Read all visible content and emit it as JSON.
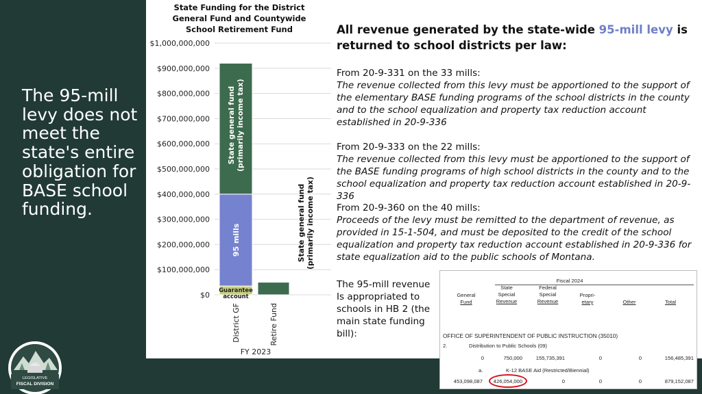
{
  "sidebar": {
    "text": "The 95-mill levy does not meet the state's entire obligation for BASE school funding.",
    "logo_text_1": "LEGISLATIVE",
    "logo_text_2": "FISCAL DIVISION"
  },
  "colors": {
    "sidebar": "#213a35",
    "bar_green": "#3d6b4e",
    "bar_blue": "#7582cf",
    "bar_guarantee": "#c9d07c",
    "heading_highlight": "#6f7fc8",
    "circle": "#d3141c"
  },
  "chart_data": {
    "type": "bar",
    "title": "State Funding for the District General Fund and Countywide School Retirement Fund",
    "categories": [
      "District GF",
      "Retire Fund"
    ],
    "xlabel": "FY 2023",
    "ylim": [
      0,
      1000000000
    ],
    "yticks": [
      "$0",
      "$100,000,000",
      "$200,000,000",
      "$300,000,000",
      "$400,000,000",
      "$500,000,000",
      "$600,000,000",
      "$700,000,000",
      "$800,000,000",
      "$900,000,000",
      "$1,000,000,000"
    ],
    "stacked": true,
    "series": [
      {
        "name": "Guarantee account",
        "color": "#c9d07c",
        "values": [
          35000000,
          0
        ]
      },
      {
        "name": "95 mills",
        "color": "#7582cf",
        "values": [
          365000000,
          0
        ]
      },
      {
        "name": "State general fund (primarily income tax)",
        "color": "#3d6b4e",
        "values": [
          520000000,
          50000000
        ]
      }
    ],
    "segment_labels": {
      "guarantee": "Guarantee account",
      "mills": "95 mills",
      "district_gf_1": "State general fund",
      "district_gf_2": "(primarily income tax)",
      "retire_1": "State general fund",
      "retire_2": "(primarily income tax)"
    }
  },
  "main": {
    "heading_1": "All revenue generated by the state-wide ",
    "heading_hl": "95-mill levy",
    "heading_2": " is returned to school districts per law:",
    "statutes": [
      {
        "cite": "From 20-9-331 on the 33 mills:",
        "quote": "The revenue collected from this levy must be apportioned to the support of the elementary BASE funding programs of the school districts in the county and to the school equalization and property tax reduction account established in 20-9-336"
      },
      {
        "cite": "From 20-9-333 on the 22 mills:",
        "quote": "The revenue collected from this levy must be apportioned to the support of the BASE funding programs of high school districts in the county and to the school equalization and property tax reduction account established in 20-9-336"
      },
      {
        "cite": "From 20-9-360 on the 40 mills:",
        "quote": "Proceeds of the levy must be remitted to the department of revenue, as provided in 15-1-504, and must be deposited to the credit of the school equalization and property tax reduction account established in 20-9-336 for state equalization aid to the public schools of Montana."
      }
    ],
    "hb2_text": "The 95-mill revenue Is appropriated to schools in HB 2 (the main state funding bill):"
  },
  "budget_table": {
    "fiscal_year": "Fiscal 2024",
    "columns": [
      [
        "General",
        "Fund"
      ],
      [
        "State",
        "Special",
        "Revenue"
      ],
      [
        "Federal",
        "Special",
        "Revenue"
      ],
      [
        "Propri-",
        "etary"
      ],
      [
        "Other"
      ],
      [
        "Total"
      ]
    ],
    "agency": "OFFICE OF SUPERINTENDENT OF PUBLIC INSTRUCTION (35010)",
    "program_num": "2.",
    "program": "Distribution to Public Schools (09)",
    "program_values": [
      "0",
      "750,000",
      "155,735,391",
      "0",
      "0",
      "156,485,391"
    ],
    "item_letter": "a.",
    "item": "K-12 BASE Aid (Restricted/Biennial)",
    "item_values": [
      "453,098,087",
      "426,054,000",
      "0",
      "0",
      "0",
      "879,152,087"
    ]
  }
}
